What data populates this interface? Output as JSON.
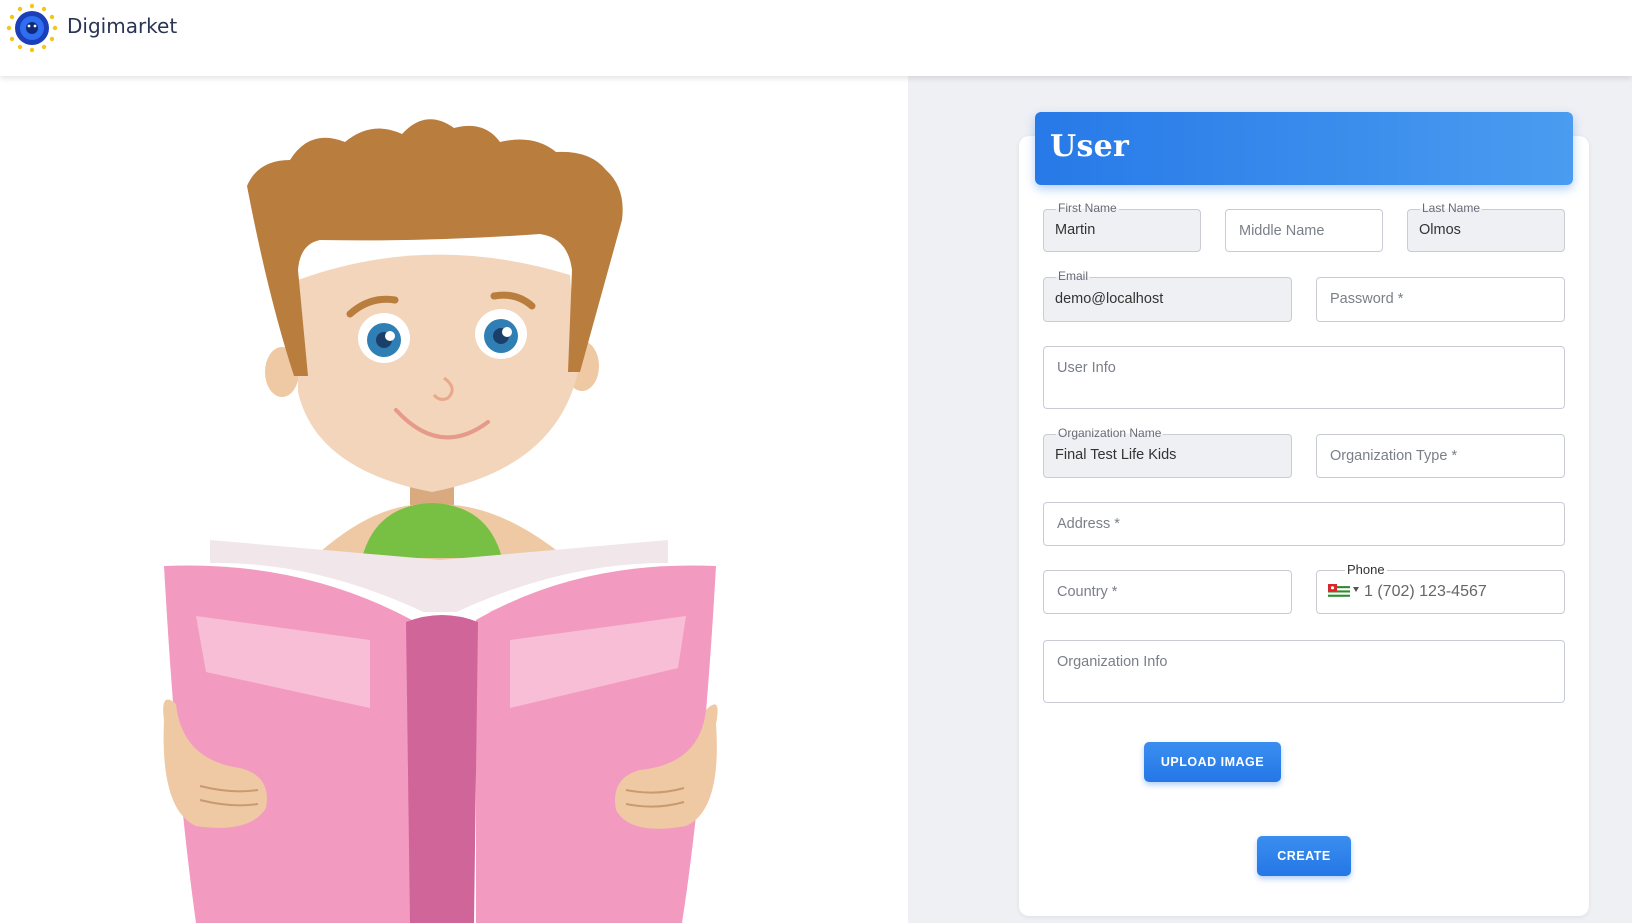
{
  "header": {
    "brand": "Digimarket",
    "logo_icon": "digimarket-logo-icon"
  },
  "form": {
    "title": "User",
    "first_name": {
      "label": "First Name",
      "value": "Martin"
    },
    "middle_name": {
      "placeholder": "Middle Name"
    },
    "last_name": {
      "label": "Last Name",
      "value": "Olmos"
    },
    "email": {
      "label": "Email",
      "value": "demo@localhost"
    },
    "password": {
      "placeholder": "Password *"
    },
    "user_info": {
      "placeholder": "User Info"
    },
    "organization_name": {
      "label": "Organization Name",
      "value": "Final Test Life Kids"
    },
    "organization_type": {
      "placeholder": "Organization Type *"
    },
    "address": {
      "placeholder": "Address *"
    },
    "country": {
      "placeholder": "Country *"
    },
    "phone": {
      "label": "Phone",
      "value": "1 (702) 123-4567",
      "flag_icon": "abkhazia-flag-icon"
    },
    "organization_info": {
      "placeholder": "Organization Info"
    },
    "upload_button": "UPLOAD IMAGE",
    "create_button": "CREATE"
  },
  "colors": {
    "accent": "#2779e8",
    "background_right": "#eff0f4",
    "input_filled": "#eff0f4"
  }
}
